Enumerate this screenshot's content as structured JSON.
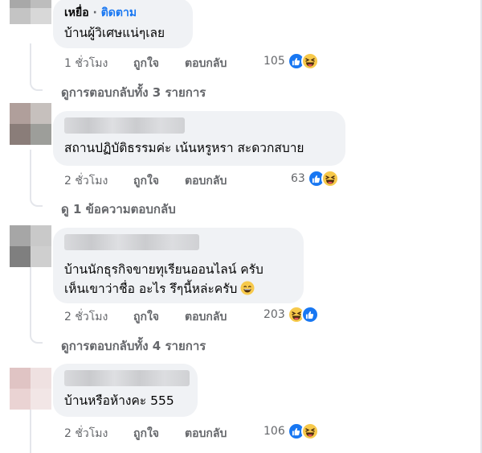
{
  "comments": [
    {
      "author": "เหยื่อ",
      "follow_label": "ติดตาม",
      "text_lines": [
        "บ้านผู้วิเศษแน่ๆเลย"
      ],
      "time": "1 ชั่วโมง",
      "like_label": "ถูกใจ",
      "reply_label": "ตอบกลับ",
      "reaction_count": "105",
      "reactions": [
        "like",
        "haha"
      ],
      "replies_link": "ดูการตอบกลับทั้ง 3 รายการ",
      "avatar_colors": [
        "#a8a8a8",
        "#bdbdbd",
        "#c4c4c4",
        "#d8d8d8"
      ]
    },
    {
      "author": "",
      "text_lines": [
        "สถานปฏิบัติธรรมค่ะ เน้นหรูหรา สะดวกสบาย"
      ],
      "time": "2 ชั่วโมง",
      "like_label": "ถูกใจ",
      "reply_label": "ตอบกลับ",
      "reaction_count": "63",
      "reactions": [
        "like",
        "haha"
      ],
      "replies_link": "ดู 1 ข้อความตอบกลับ",
      "avatar_colors": [
        "#b09f9b",
        "#c6c0bd",
        "#8a7d79",
        "#9d9e9a"
      ]
    },
    {
      "author": "",
      "text_lines": [
        "บ้านนักธุรกิจขายทุเรียนออนไลน์ ครับ",
        "เห็นเขาว่าชื่อ อะไร รึๆนี้หล่ะครับ"
      ],
      "time": "2 ชั่วโมง",
      "like_label": "ถูกใจ",
      "reply_label": "ตอบกลับ",
      "reaction_count": "203",
      "reactions": [
        "haha",
        "like"
      ],
      "replies_link": "ดูการตอบกลับทั้ง 4 รายการ",
      "avatar_colors": [
        "#a6a6a6",
        "#c9c9c9",
        "#7f7f7f",
        "#cfcfcf"
      ]
    },
    {
      "author": "",
      "text_lines": [
        "บ้านหรือห้างคะ 555"
      ],
      "time": "2 ชั่วโมง",
      "like_label": "ถูกใจ",
      "reply_label": "ตอบกลับ",
      "reaction_count": "106",
      "reactions": [
        "like",
        "haha"
      ],
      "avatar_colors": [
        "#e0c4c4",
        "#efe1e1",
        "#ead3d3",
        "#f2e6e6"
      ]
    }
  ]
}
